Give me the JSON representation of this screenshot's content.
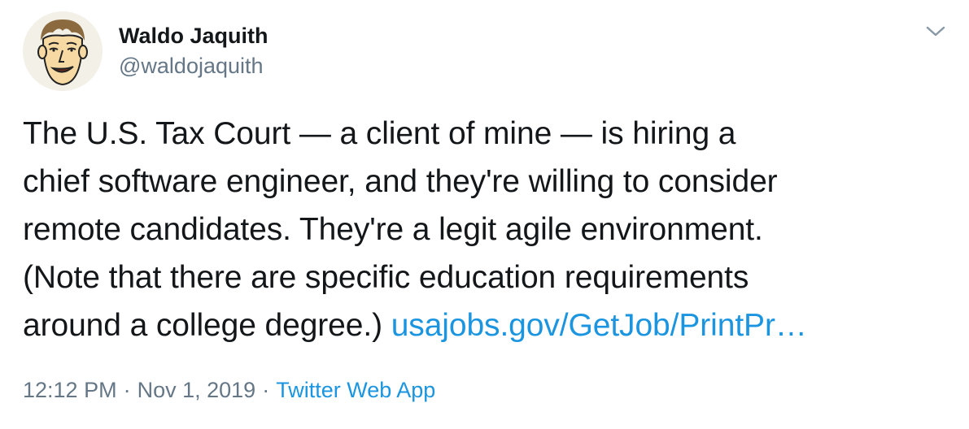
{
  "author": {
    "name": "Waldo Jaquith",
    "handle": "@waldojaquith"
  },
  "tweet": {
    "lines": [
      "The U.S. Tax Court — a client of mine — is hiring a",
      "chief software engineer, and they're willing to consider",
      "remote candidates. They're a legit agile environment.",
      "(Note that there are specific education requirements"
    ],
    "last_line_text": "around a college degree.) ",
    "link_text": "usajobs.gov/GetJob/PrintPr…"
  },
  "meta": {
    "time": "12:12 PM",
    "separator": "·",
    "date": "Nov 1, 2019",
    "source": "Twitter Web App"
  },
  "icons": {
    "caret": "chevron-down-icon",
    "avatar": "cartoon-face-avatar"
  },
  "colors": {
    "text": "#14171a",
    "secondary": "#657786",
    "link": "#1b95e0"
  }
}
